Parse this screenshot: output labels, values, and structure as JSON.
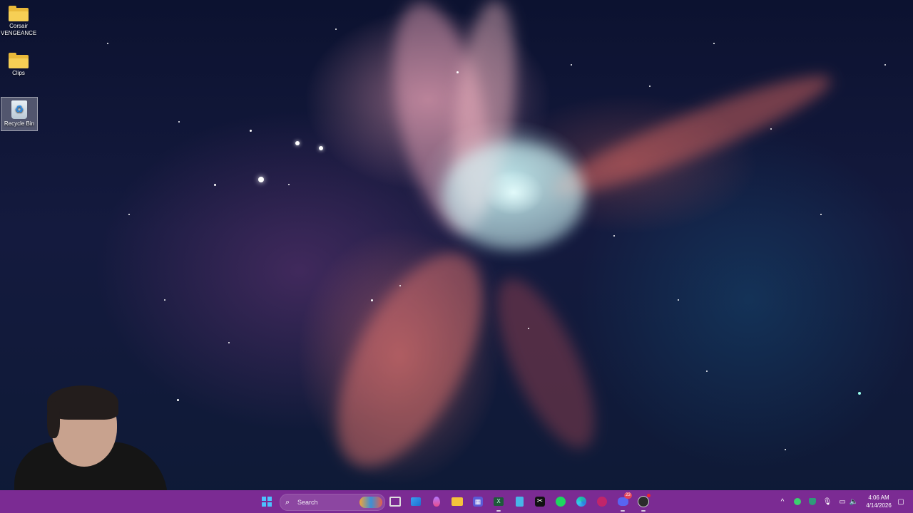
{
  "desktop": {
    "icons": [
      {
        "label_line1": "Corsair",
        "label_line2": "VENGEANCE",
        "icon": "folder-icon"
      },
      {
        "label_line1": "Clips",
        "label_line2": "",
        "icon": "folder-icon"
      },
      {
        "label_line1": "Recycle Bin",
        "label_line2": "",
        "icon": "recycle-bin-icon",
        "selected": true
      }
    ]
  },
  "taskbar": {
    "background": "#7b2b93",
    "start_icon": "windows-logo-icon",
    "search": {
      "placeholder": "Search",
      "icon": "search-icon"
    },
    "pinned_apps": [
      {
        "name": "task-view",
        "icon": "task-view-icon"
      },
      {
        "name": "store",
        "icon": "store-icon"
      },
      {
        "name": "droplet-app",
        "icon": "droplet-icon"
      },
      {
        "name": "file-explorer",
        "icon": "folder-icon"
      },
      {
        "name": "app-grid",
        "icon": "grid-icon"
      },
      {
        "name": "terminal",
        "icon": "terminal-icon"
      },
      {
        "name": "notepad",
        "icon": "notepad-icon"
      },
      {
        "name": "capcut",
        "icon": "capcut-icon"
      },
      {
        "name": "spotify",
        "icon": "spotify-icon"
      },
      {
        "name": "edge",
        "icon": "edge-icon"
      },
      {
        "name": "instagram",
        "icon": "instagram-icon"
      },
      {
        "name": "discord",
        "icon": "discord-icon",
        "badge": "23"
      },
      {
        "name": "obs",
        "icon": "obs-icon"
      }
    ],
    "tray": {
      "icons": [
        "chevron-up-icon",
        "green-app-icon",
        "shield-icon",
        "microphone-icon",
        "network-icon",
        "speaker-icon"
      ],
      "time": "4:06 AM",
      "date": "4/14/2026",
      "notification_icon": "notification-icon"
    }
  }
}
